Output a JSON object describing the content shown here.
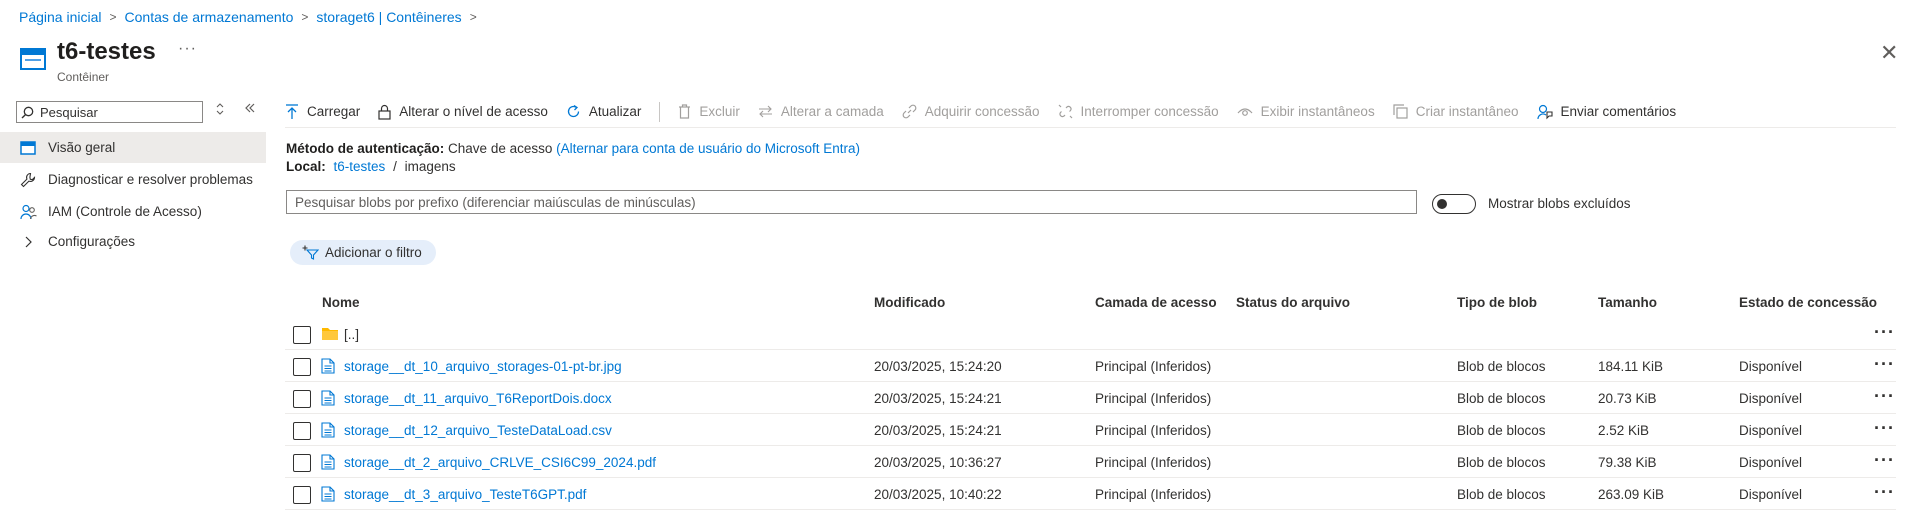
{
  "breadcrumb": [
    "Página inicial",
    "Contas de armazenamento",
    "storaget6 | Contêineres"
  ],
  "header": {
    "title": "t6-testes",
    "subtitle": "Contêiner",
    "more": "···",
    "close": "✕"
  },
  "nav": {
    "search_placeholder": "Pesquisar",
    "items": [
      {
        "label": "Visão geral",
        "icon": "overview-icon"
      },
      {
        "label": "Diagnosticar e resolver problemas",
        "icon": "wrench-icon"
      },
      {
        "label": "IAM (Controle de Acesso)",
        "icon": "people-icon"
      },
      {
        "label": "Configurações",
        "icon": "chevron-right-icon"
      }
    ]
  },
  "toolbar": {
    "upload": "Carregar",
    "change_access": "Alterar o nível de acesso",
    "refresh": "Atualizar",
    "delete": "Excluir",
    "change_tier": "Alterar a camada",
    "acquire_lease": "Adquirir concessão",
    "break_lease": "Interromper concessão",
    "view_snapshots": "Exibir instantâneos",
    "create_snapshot": "Criar instantâneo",
    "feedback": "Enviar comentários"
  },
  "info": {
    "auth_label": "Método de autenticação:",
    "auth_value": "Chave de acesso",
    "auth_link": "(Alternar para conta de usuário do Microsoft Entra)",
    "location_label": "Local:",
    "location_link": "t6-testes",
    "location_sep": "/",
    "location_folder": "imagens"
  },
  "blob_search": {
    "placeholder": "Pesquisar blobs por prefixo (diferenciar maiúsculas de minúsculas)"
  },
  "toggle": {
    "label": "Mostrar blobs excluídos"
  },
  "filter": {
    "label": "Adicionar o filtro"
  },
  "table": {
    "columns": [
      "Nome",
      "Modificado",
      "Camada de acesso",
      "Status do arquivo",
      "Tipo de blob",
      "Tamanho",
      "Estado de concessão"
    ],
    "parent": "[..]",
    "rows": [
      {
        "name": "storage__dt_10_arquivo_storages-01-pt-br.jpg",
        "modified": "20/03/2025, 15:24:20",
        "tier": "Principal (Inferidos)",
        "status": "",
        "type": "Blob de blocos",
        "size": "184.11 KiB",
        "lease": "Disponível"
      },
      {
        "name": "storage__dt_11_arquivo_T6ReportDois.docx",
        "modified": "20/03/2025, 15:24:21",
        "tier": "Principal (Inferidos)",
        "status": "",
        "type": "Blob de blocos",
        "size": "20.73 KiB",
        "lease": "Disponível"
      },
      {
        "name": "storage__dt_12_arquivo_TesteDataLoad.csv",
        "modified": "20/03/2025, 15:24:21",
        "tier": "Principal (Inferidos)",
        "status": "",
        "type": "Blob de blocos",
        "size": "2.52 KiB",
        "lease": "Disponível"
      },
      {
        "name": "storage__dt_2_arquivo_CRLVE_CSI6C99_2024.pdf",
        "modified": "20/03/2025, 10:36:27",
        "tier": "Principal (Inferidos)",
        "status": "",
        "type": "Blob de blocos",
        "size": "79.38 KiB",
        "lease": "Disponível"
      },
      {
        "name": "storage__dt_3_arquivo_TesteT6GPT.pdf",
        "modified": "20/03/2025, 10:40:22",
        "tier": "Principal (Inferidos)",
        "status": "",
        "type": "Blob de blocos",
        "size": "263.09 KiB",
        "lease": "Disponível"
      }
    ]
  },
  "colors": {
    "accent": "#0078d4",
    "folder": "#ffb900",
    "nav_active": "#edebe9",
    "filter_pill": "#e5eefa"
  }
}
